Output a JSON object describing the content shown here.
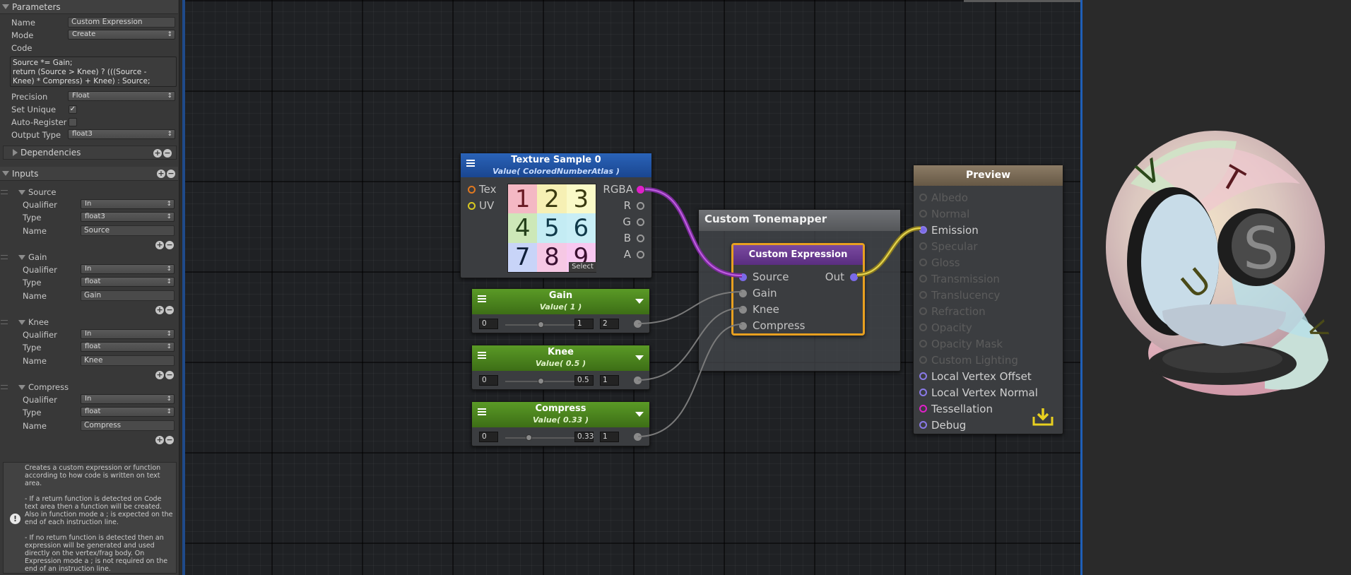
{
  "left_panel": {
    "parameters_header": "Parameters",
    "name_label": "Name",
    "name_value": "Custom Expression",
    "mode_label": "Mode",
    "mode_value": "Create",
    "code_label": "Code",
    "code_lines": [
      "Source *= Gain;",
      "return (Source > Knee) ? (((Source -",
      "Knee) * Compress) + Knee) : Source;"
    ],
    "precision_label": "Precision",
    "precision_value": "Float",
    "set_unique_label": "Set Unique",
    "set_unique_checked": true,
    "auto_register_label": "Auto-Register",
    "auto_register_checked": false,
    "output_type_label": "Output Type",
    "output_type_value": "float3",
    "dependencies_label": "Dependencies",
    "inputs_header": "Inputs",
    "inputs": [
      {
        "title": "Source",
        "qualifier_label": "Qualifier",
        "qualifier": "In",
        "type_label": "Type",
        "type": "float3",
        "name_label": "Name",
        "name": "Source"
      },
      {
        "title": "Gain",
        "qualifier_label": "Qualifier",
        "qualifier": "In",
        "type_label": "Type",
        "type": "float",
        "name_label": "Name",
        "name": "Gain"
      },
      {
        "title": "Knee",
        "qualifier_label": "Qualifier",
        "qualifier": "In",
        "type_label": "Type",
        "type": "float",
        "name_label": "Name",
        "name": "Knee"
      },
      {
        "title": "Compress",
        "qualifier_label": "Qualifier",
        "qualifier": "In",
        "type_label": "Type",
        "type": "float",
        "name_label": "Name",
        "name": "Compress"
      }
    ],
    "help_text": [
      "Creates a custom expression or function according to how code is written on text area.",
      "- If a return function is detected on Code text area then a function will be created. Also in function mode a ; is expected on the end of each instruction line.",
      "- If no return function is detected then an expression will be generated and used directly on the vertex/frag body. On Expression mode a ; is not required on the end of an instruction line."
    ]
  },
  "texture_node": {
    "title": "Texture Sample 0",
    "subtitle": "Value( ColoredNumberAtlas )",
    "inputs": [
      "Tex",
      "UV"
    ],
    "outputs": [
      "RGBA",
      "R",
      "G",
      "B",
      "A"
    ],
    "select_label": "Select",
    "atlas_digits": [
      "1",
      "2",
      "3",
      "4",
      "5",
      "6",
      "7",
      "8",
      "9"
    ],
    "atlas_colors": [
      "#f4b8c4",
      "#f6f0b4",
      "#fafac8",
      "#cde8b8",
      "#c4ecf4",
      "#c8eef6",
      "#c8d4f8",
      "#f6c8e4",
      "#f8c8f0"
    ],
    "atlas_text_colors": [
      "#6a1a24",
      "#3a3a10",
      "#3a3a10",
      "#24401a",
      "#103a4a",
      "#103a4a",
      "#10203a",
      "#3a1030",
      "#3a1030"
    ]
  },
  "gain_node": {
    "title": "Gain",
    "subtitle": "Value( 1 )",
    "min": "0",
    "value": "1",
    "max": "2",
    "slider_fraction": 0.5
  },
  "knee_node": {
    "title": "Knee",
    "subtitle": "Value( 0.5 )",
    "min": "0",
    "value": "0.5",
    "max": "1",
    "slider_fraction": 0.5
  },
  "compress_node": {
    "title": "Compress",
    "subtitle": "Value( 0.33 )",
    "min": "0",
    "value": "0.33",
    "max": "1",
    "slider_fraction": 0.33
  },
  "tonemapper_group": {
    "title": "Custom Tonemapper"
  },
  "custom_expression_node": {
    "title": "Custom Expression",
    "inputs": [
      "Source",
      "Gain",
      "Knee",
      "Compress"
    ],
    "output": "Out"
  },
  "output_node": {
    "title": "Preview",
    "ports": [
      {
        "label": "Albedo",
        "active": false
      },
      {
        "label": "Normal",
        "active": false
      },
      {
        "label": "Emission",
        "active": true,
        "connected": true
      },
      {
        "label": "Specular",
        "active": false
      },
      {
        "label": "Gloss",
        "active": false
      },
      {
        "label": "Transmission",
        "active": false
      },
      {
        "label": "Translucency",
        "active": false
      },
      {
        "label": "Refraction",
        "active": false
      },
      {
        "label": "Opacity",
        "active": false
      },
      {
        "label": "Opacity Mask",
        "active": false
      },
      {
        "label": "Custom Lighting",
        "active": false
      },
      {
        "label": "Local Vertex Offset",
        "active": true
      },
      {
        "label": "Local Vertex Normal",
        "active": true
      },
      {
        "label": "Tessellation",
        "active": true,
        "pink": true
      },
      {
        "label": "Debug",
        "active": true
      }
    ]
  },
  "colors": {
    "texture_header": "#1f4f9a",
    "value_header": "#4a7d1c",
    "expression_header": "#6a3c8c",
    "output_header": "#7a6a55",
    "selection": "#e8a020",
    "rgba_port": "#e020c8",
    "wire_purple": "#b050d0",
    "wire_yellow": "#d8c840",
    "wire_gray": "#8a8a8a"
  },
  "preview_letters": [
    "V",
    "T",
    "S",
    "U",
    "3",
    "V"
  ]
}
